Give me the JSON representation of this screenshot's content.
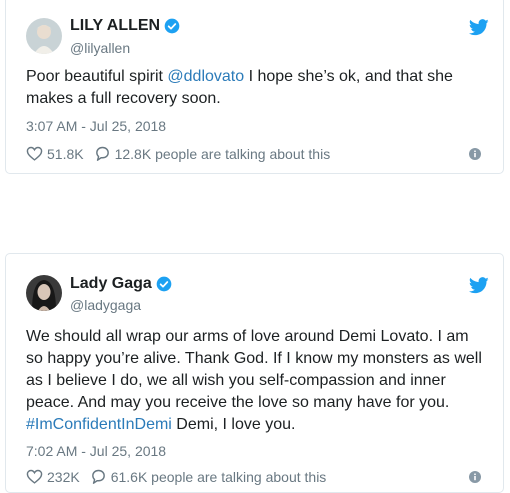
{
  "tweets": [
    {
      "name": "LILY ALLEN",
      "handle": "@lilyallen",
      "text_before": "Poor beautiful spirit ",
      "mention": "@ddlovato",
      "text_after": " I hope she’s ok, and that she makes a full recovery soon.",
      "timestamp": "3:07 AM - Jul 25, 2018",
      "likes": "51.8K",
      "replies": "12.8K people are talking about this"
    },
    {
      "name": "Lady Gaga",
      "handle": "@ladygaga",
      "text_before": "We should all wrap our arms of love around Demi Lovato. I am so happy you’re alive. Thank God. If I know my monsters as well as I believe I do, we all wish you self-compassion and inner peace. And may you receive the love so many have for you. ",
      "hashtag": "#ImConfidentInDemi",
      "text_after": " Demi, I love you.",
      "timestamp": "7:02 AM - Jul 25, 2018",
      "likes": "232K",
      "replies": "61.6K people are talking about this"
    }
  ],
  "colors": {
    "twitter_blue": "#1da1f2",
    "link": "#2b7bb9",
    "secondary_text": "#697882",
    "border": "#e1e8ed"
  },
  "icons": [
    "verified-icon",
    "twitter-bird-icon",
    "heart-icon",
    "reply-icon",
    "info-icon"
  ]
}
